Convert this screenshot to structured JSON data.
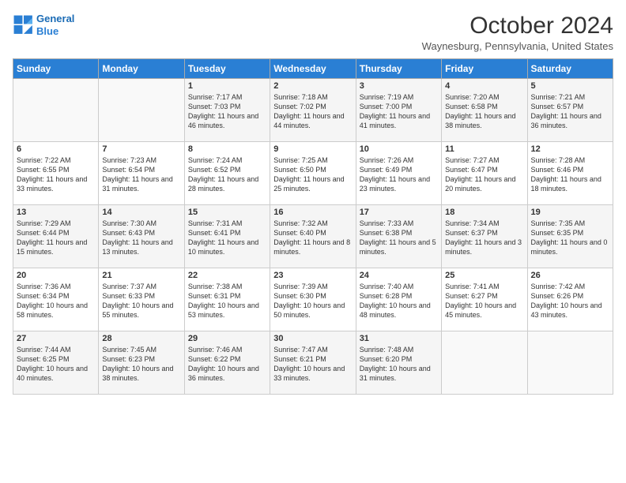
{
  "logo": {
    "line1": "General",
    "line2": "Blue"
  },
  "header": {
    "month_year": "October 2024",
    "location": "Waynesburg, Pennsylvania, United States"
  },
  "weekdays": [
    "Sunday",
    "Monday",
    "Tuesday",
    "Wednesday",
    "Thursday",
    "Friday",
    "Saturday"
  ],
  "weeks": [
    [
      {
        "day": "",
        "sunrise": "",
        "sunset": "",
        "daylight": ""
      },
      {
        "day": "",
        "sunrise": "",
        "sunset": "",
        "daylight": ""
      },
      {
        "day": "1",
        "sunrise": "Sunrise: 7:17 AM",
        "sunset": "Sunset: 7:03 PM",
        "daylight": "Daylight: 11 hours and 46 minutes."
      },
      {
        "day": "2",
        "sunrise": "Sunrise: 7:18 AM",
        "sunset": "Sunset: 7:02 PM",
        "daylight": "Daylight: 11 hours and 44 minutes."
      },
      {
        "day": "3",
        "sunrise": "Sunrise: 7:19 AM",
        "sunset": "Sunset: 7:00 PM",
        "daylight": "Daylight: 11 hours and 41 minutes."
      },
      {
        "day": "4",
        "sunrise": "Sunrise: 7:20 AM",
        "sunset": "Sunset: 6:58 PM",
        "daylight": "Daylight: 11 hours and 38 minutes."
      },
      {
        "day": "5",
        "sunrise": "Sunrise: 7:21 AM",
        "sunset": "Sunset: 6:57 PM",
        "daylight": "Daylight: 11 hours and 36 minutes."
      }
    ],
    [
      {
        "day": "6",
        "sunrise": "Sunrise: 7:22 AM",
        "sunset": "Sunset: 6:55 PM",
        "daylight": "Daylight: 11 hours and 33 minutes."
      },
      {
        "day": "7",
        "sunrise": "Sunrise: 7:23 AM",
        "sunset": "Sunset: 6:54 PM",
        "daylight": "Daylight: 11 hours and 31 minutes."
      },
      {
        "day": "8",
        "sunrise": "Sunrise: 7:24 AM",
        "sunset": "Sunset: 6:52 PM",
        "daylight": "Daylight: 11 hours and 28 minutes."
      },
      {
        "day": "9",
        "sunrise": "Sunrise: 7:25 AM",
        "sunset": "Sunset: 6:50 PM",
        "daylight": "Daylight: 11 hours and 25 minutes."
      },
      {
        "day": "10",
        "sunrise": "Sunrise: 7:26 AM",
        "sunset": "Sunset: 6:49 PM",
        "daylight": "Daylight: 11 hours and 23 minutes."
      },
      {
        "day": "11",
        "sunrise": "Sunrise: 7:27 AM",
        "sunset": "Sunset: 6:47 PM",
        "daylight": "Daylight: 11 hours and 20 minutes."
      },
      {
        "day": "12",
        "sunrise": "Sunrise: 7:28 AM",
        "sunset": "Sunset: 6:46 PM",
        "daylight": "Daylight: 11 hours and 18 minutes."
      }
    ],
    [
      {
        "day": "13",
        "sunrise": "Sunrise: 7:29 AM",
        "sunset": "Sunset: 6:44 PM",
        "daylight": "Daylight: 11 hours and 15 minutes."
      },
      {
        "day": "14",
        "sunrise": "Sunrise: 7:30 AM",
        "sunset": "Sunset: 6:43 PM",
        "daylight": "Daylight: 11 hours and 13 minutes."
      },
      {
        "day": "15",
        "sunrise": "Sunrise: 7:31 AM",
        "sunset": "Sunset: 6:41 PM",
        "daylight": "Daylight: 11 hours and 10 minutes."
      },
      {
        "day": "16",
        "sunrise": "Sunrise: 7:32 AM",
        "sunset": "Sunset: 6:40 PM",
        "daylight": "Daylight: 11 hours and 8 minutes."
      },
      {
        "day": "17",
        "sunrise": "Sunrise: 7:33 AM",
        "sunset": "Sunset: 6:38 PM",
        "daylight": "Daylight: 11 hours and 5 minutes."
      },
      {
        "day": "18",
        "sunrise": "Sunrise: 7:34 AM",
        "sunset": "Sunset: 6:37 PM",
        "daylight": "Daylight: 11 hours and 3 minutes."
      },
      {
        "day": "19",
        "sunrise": "Sunrise: 7:35 AM",
        "sunset": "Sunset: 6:35 PM",
        "daylight": "Daylight: 11 hours and 0 minutes."
      }
    ],
    [
      {
        "day": "20",
        "sunrise": "Sunrise: 7:36 AM",
        "sunset": "Sunset: 6:34 PM",
        "daylight": "Daylight: 10 hours and 58 minutes."
      },
      {
        "day": "21",
        "sunrise": "Sunrise: 7:37 AM",
        "sunset": "Sunset: 6:33 PM",
        "daylight": "Daylight: 10 hours and 55 minutes."
      },
      {
        "day": "22",
        "sunrise": "Sunrise: 7:38 AM",
        "sunset": "Sunset: 6:31 PM",
        "daylight": "Daylight: 10 hours and 53 minutes."
      },
      {
        "day": "23",
        "sunrise": "Sunrise: 7:39 AM",
        "sunset": "Sunset: 6:30 PM",
        "daylight": "Daylight: 10 hours and 50 minutes."
      },
      {
        "day": "24",
        "sunrise": "Sunrise: 7:40 AM",
        "sunset": "Sunset: 6:28 PM",
        "daylight": "Daylight: 10 hours and 48 minutes."
      },
      {
        "day": "25",
        "sunrise": "Sunrise: 7:41 AM",
        "sunset": "Sunset: 6:27 PM",
        "daylight": "Daylight: 10 hours and 45 minutes."
      },
      {
        "day": "26",
        "sunrise": "Sunrise: 7:42 AM",
        "sunset": "Sunset: 6:26 PM",
        "daylight": "Daylight: 10 hours and 43 minutes."
      }
    ],
    [
      {
        "day": "27",
        "sunrise": "Sunrise: 7:44 AM",
        "sunset": "Sunset: 6:25 PM",
        "daylight": "Daylight: 10 hours and 40 minutes."
      },
      {
        "day": "28",
        "sunrise": "Sunrise: 7:45 AM",
        "sunset": "Sunset: 6:23 PM",
        "daylight": "Daylight: 10 hours and 38 minutes."
      },
      {
        "day": "29",
        "sunrise": "Sunrise: 7:46 AM",
        "sunset": "Sunset: 6:22 PM",
        "daylight": "Daylight: 10 hours and 36 minutes."
      },
      {
        "day": "30",
        "sunrise": "Sunrise: 7:47 AM",
        "sunset": "Sunset: 6:21 PM",
        "daylight": "Daylight: 10 hours and 33 minutes."
      },
      {
        "day": "31",
        "sunrise": "Sunrise: 7:48 AM",
        "sunset": "Sunset: 6:20 PM",
        "daylight": "Daylight: 10 hours and 31 minutes."
      },
      {
        "day": "",
        "sunrise": "",
        "sunset": "",
        "daylight": ""
      },
      {
        "day": "",
        "sunrise": "",
        "sunset": "",
        "daylight": ""
      }
    ]
  ]
}
